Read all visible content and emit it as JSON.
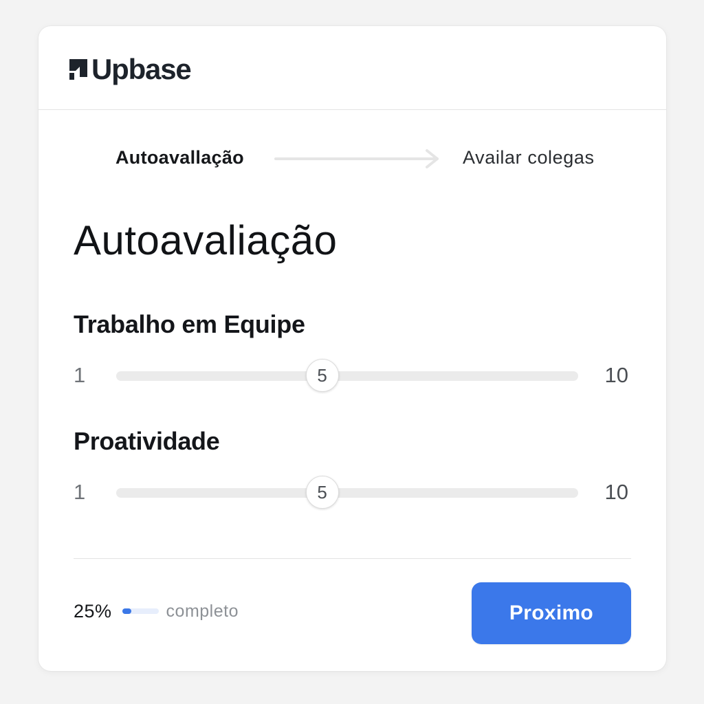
{
  "brand": {
    "name": "Upbase",
    "logo_icon": "upbase-logo-icon",
    "color": "#1d232b"
  },
  "stepper": {
    "current_step": "Autoavallação",
    "next_step": "Availar colegas",
    "arrow_icon": "arrow-right-icon"
  },
  "page_title": "Autoavaliação",
  "questions": [
    {
      "label": "Trabalho em Equipe",
      "min_label": "1",
      "max_label": "10",
      "min": 1,
      "max": 10,
      "value": 5,
      "value_label": "5"
    },
    {
      "label": "Proatividade",
      "min_label": "1",
      "max_label": "10",
      "min": 1,
      "max": 10,
      "value": 5,
      "value_label": "5"
    }
  ],
  "footer": {
    "progress_label": "25%",
    "progress_value": 0.25,
    "progress_text": "completo",
    "next_button_label": "Proximo"
  },
  "colors": {
    "accent": "#3b78ea",
    "track": "#ebebeb",
    "background": "#f3f3f3",
    "card": "#ffffff"
  }
}
